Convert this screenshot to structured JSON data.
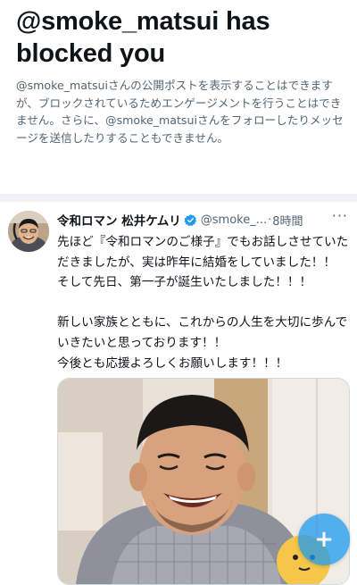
{
  "blocked_notice": {
    "title": "@smoke_matsui has blocked you",
    "description": "@smoke_matsuiさんの公開ポストを表示することはできますが、ブロックされているためエンゲージメントを行うことはできません。さらに、@smoke_matsuiさんをフォローしたりメッセージを送信したりすることもできません。"
  },
  "tweet": {
    "display_name": "令和ロマン 松井ケムリ",
    "handle": "@smoke_...",
    "separator": "·",
    "timestamp": "8時間",
    "more_icon": "ellipsis-icon",
    "verified_icon": "verified-badge-icon",
    "body_lines": [
      "先ほど『令和ロマンのご様子』でもお話しさせていただきましたが、実は昨年に結婚をしていました！！",
      "そして先日、第一子が誕生いたしました！！！",
      "",
      "新しい家族とともに、これからの人生を大切に歩んでいきたいと思っております！！",
      "今後とも応援よろしくお願いします！！！"
    ]
  },
  "fab": {
    "icon": "compose-plus-icon",
    "label": "+"
  },
  "colors": {
    "accent": "#1d9bf0",
    "text_primary": "#0f1419",
    "text_secondary": "#536471",
    "divider": "#eff3f4"
  }
}
